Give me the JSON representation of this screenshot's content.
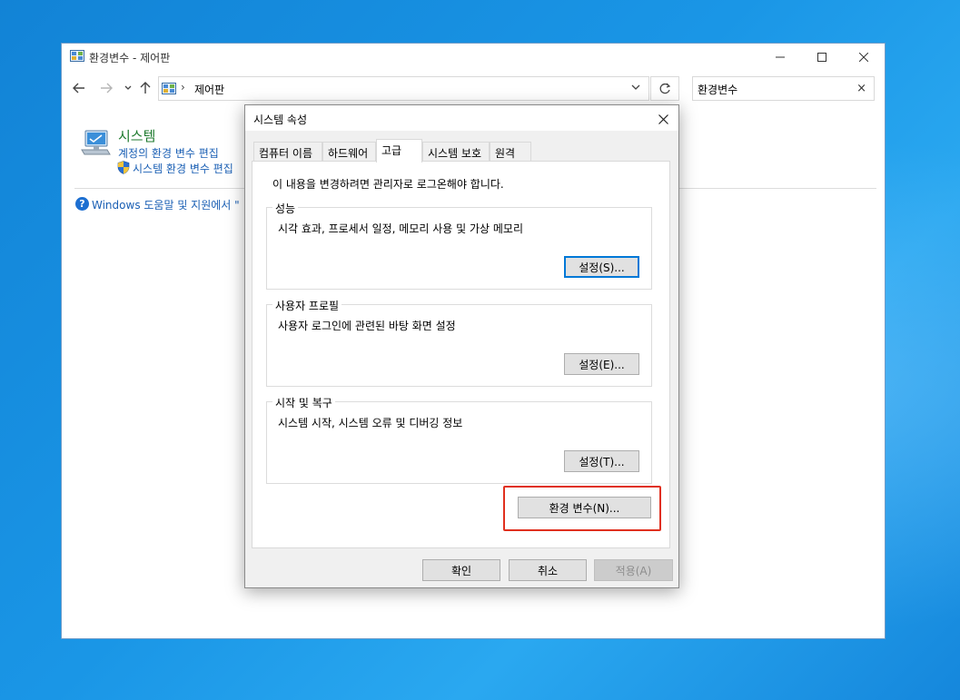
{
  "colors": {
    "desktop": "#1a96e6",
    "link": "#1a5fb4",
    "heading_green": "#1e7a2e",
    "highlight": "#e0301e",
    "focus_border": "#0078d7"
  },
  "control_panel": {
    "title": "환경변수 - 제어판",
    "address": {
      "separator": "›",
      "path": "제어판"
    },
    "search": {
      "value": "환경변수",
      "clear": "×"
    },
    "system": {
      "heading": "시스템",
      "link_edit_account_env": "계정의 환경 변수 편집",
      "link_edit_system_env": "시스템 환경 변수 편집"
    },
    "help_icon": "?",
    "help_link": "Windows 도움말 및 지원에서 \""
  },
  "dialog": {
    "title": "시스템 속성",
    "tabs": [
      {
        "label": "컴퓨터 이름",
        "active": false
      },
      {
        "label": "하드웨어",
        "active": false
      },
      {
        "label": "고급",
        "active": true
      },
      {
        "label": "시스템 보호",
        "active": false
      },
      {
        "label": "원격",
        "active": false
      }
    ],
    "notice": "이 내용을 변경하려면 관리자로 로그온해야 합니다.",
    "groups": [
      {
        "label": "성능",
        "description": "시각 효과, 프로세서 일정, 메모리 사용 및 가상 메모리",
        "button": "설정(S)..."
      },
      {
        "label": "사용자 프로필",
        "description": "사용자 로그인에 관련된 바탕 화면 설정",
        "button": "설정(E)..."
      },
      {
        "label": "시작 및 복구",
        "description": "시스템 시작, 시스템 오류 및 디버깅 정보",
        "button": "설정(T)..."
      }
    ],
    "env_button": "환경 변수(N)...",
    "ok_button": "확인",
    "cancel_button": "취소",
    "apply_button": "적용(A)"
  }
}
